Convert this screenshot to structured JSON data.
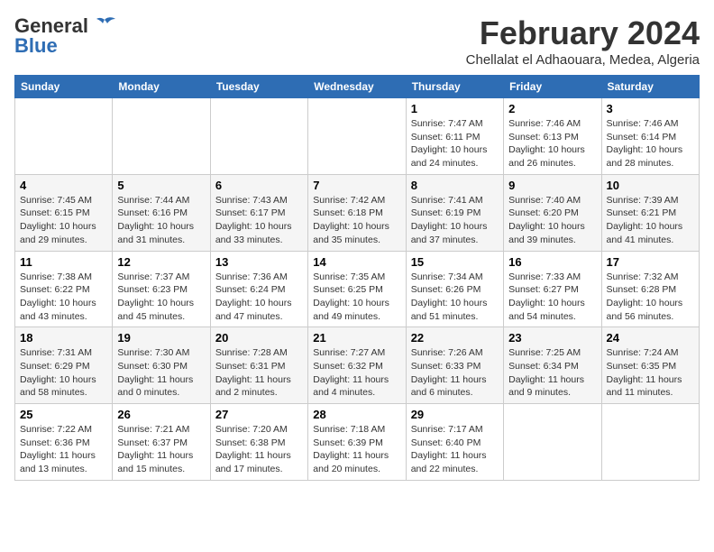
{
  "header": {
    "logo_general": "General",
    "logo_blue": "Blue",
    "month_year": "February 2024",
    "location": "Chellalat el Adhaouara, Medea, Algeria"
  },
  "weekdays": [
    "Sunday",
    "Monday",
    "Tuesday",
    "Wednesday",
    "Thursday",
    "Friday",
    "Saturday"
  ],
  "weeks": [
    [
      {
        "day": "",
        "info": ""
      },
      {
        "day": "",
        "info": ""
      },
      {
        "day": "",
        "info": ""
      },
      {
        "day": "",
        "info": ""
      },
      {
        "day": "1",
        "info": "Sunrise: 7:47 AM\nSunset: 6:11 PM\nDaylight: 10 hours and 24 minutes."
      },
      {
        "day": "2",
        "info": "Sunrise: 7:46 AM\nSunset: 6:13 PM\nDaylight: 10 hours and 26 minutes."
      },
      {
        "day": "3",
        "info": "Sunrise: 7:46 AM\nSunset: 6:14 PM\nDaylight: 10 hours and 28 minutes."
      }
    ],
    [
      {
        "day": "4",
        "info": "Sunrise: 7:45 AM\nSunset: 6:15 PM\nDaylight: 10 hours and 29 minutes."
      },
      {
        "day": "5",
        "info": "Sunrise: 7:44 AM\nSunset: 6:16 PM\nDaylight: 10 hours and 31 minutes."
      },
      {
        "day": "6",
        "info": "Sunrise: 7:43 AM\nSunset: 6:17 PM\nDaylight: 10 hours and 33 minutes."
      },
      {
        "day": "7",
        "info": "Sunrise: 7:42 AM\nSunset: 6:18 PM\nDaylight: 10 hours and 35 minutes."
      },
      {
        "day": "8",
        "info": "Sunrise: 7:41 AM\nSunset: 6:19 PM\nDaylight: 10 hours and 37 minutes."
      },
      {
        "day": "9",
        "info": "Sunrise: 7:40 AM\nSunset: 6:20 PM\nDaylight: 10 hours and 39 minutes."
      },
      {
        "day": "10",
        "info": "Sunrise: 7:39 AM\nSunset: 6:21 PM\nDaylight: 10 hours and 41 minutes."
      }
    ],
    [
      {
        "day": "11",
        "info": "Sunrise: 7:38 AM\nSunset: 6:22 PM\nDaylight: 10 hours and 43 minutes."
      },
      {
        "day": "12",
        "info": "Sunrise: 7:37 AM\nSunset: 6:23 PM\nDaylight: 10 hours and 45 minutes."
      },
      {
        "day": "13",
        "info": "Sunrise: 7:36 AM\nSunset: 6:24 PM\nDaylight: 10 hours and 47 minutes."
      },
      {
        "day": "14",
        "info": "Sunrise: 7:35 AM\nSunset: 6:25 PM\nDaylight: 10 hours and 49 minutes."
      },
      {
        "day": "15",
        "info": "Sunrise: 7:34 AM\nSunset: 6:26 PM\nDaylight: 10 hours and 51 minutes."
      },
      {
        "day": "16",
        "info": "Sunrise: 7:33 AM\nSunset: 6:27 PM\nDaylight: 10 hours and 54 minutes."
      },
      {
        "day": "17",
        "info": "Sunrise: 7:32 AM\nSunset: 6:28 PM\nDaylight: 10 hours and 56 minutes."
      }
    ],
    [
      {
        "day": "18",
        "info": "Sunrise: 7:31 AM\nSunset: 6:29 PM\nDaylight: 10 hours and 58 minutes."
      },
      {
        "day": "19",
        "info": "Sunrise: 7:30 AM\nSunset: 6:30 PM\nDaylight: 11 hours and 0 minutes."
      },
      {
        "day": "20",
        "info": "Sunrise: 7:28 AM\nSunset: 6:31 PM\nDaylight: 11 hours and 2 minutes."
      },
      {
        "day": "21",
        "info": "Sunrise: 7:27 AM\nSunset: 6:32 PM\nDaylight: 11 hours and 4 minutes."
      },
      {
        "day": "22",
        "info": "Sunrise: 7:26 AM\nSunset: 6:33 PM\nDaylight: 11 hours and 6 minutes."
      },
      {
        "day": "23",
        "info": "Sunrise: 7:25 AM\nSunset: 6:34 PM\nDaylight: 11 hours and 9 minutes."
      },
      {
        "day": "24",
        "info": "Sunrise: 7:24 AM\nSunset: 6:35 PM\nDaylight: 11 hours and 11 minutes."
      }
    ],
    [
      {
        "day": "25",
        "info": "Sunrise: 7:22 AM\nSunset: 6:36 PM\nDaylight: 11 hours and 13 minutes."
      },
      {
        "day": "26",
        "info": "Sunrise: 7:21 AM\nSunset: 6:37 PM\nDaylight: 11 hours and 15 minutes."
      },
      {
        "day": "27",
        "info": "Sunrise: 7:20 AM\nSunset: 6:38 PM\nDaylight: 11 hours and 17 minutes."
      },
      {
        "day": "28",
        "info": "Sunrise: 7:18 AM\nSunset: 6:39 PM\nDaylight: 11 hours and 20 minutes."
      },
      {
        "day": "29",
        "info": "Sunrise: 7:17 AM\nSunset: 6:40 PM\nDaylight: 11 hours and 22 minutes."
      },
      {
        "day": "",
        "info": ""
      },
      {
        "day": "",
        "info": ""
      }
    ]
  ]
}
